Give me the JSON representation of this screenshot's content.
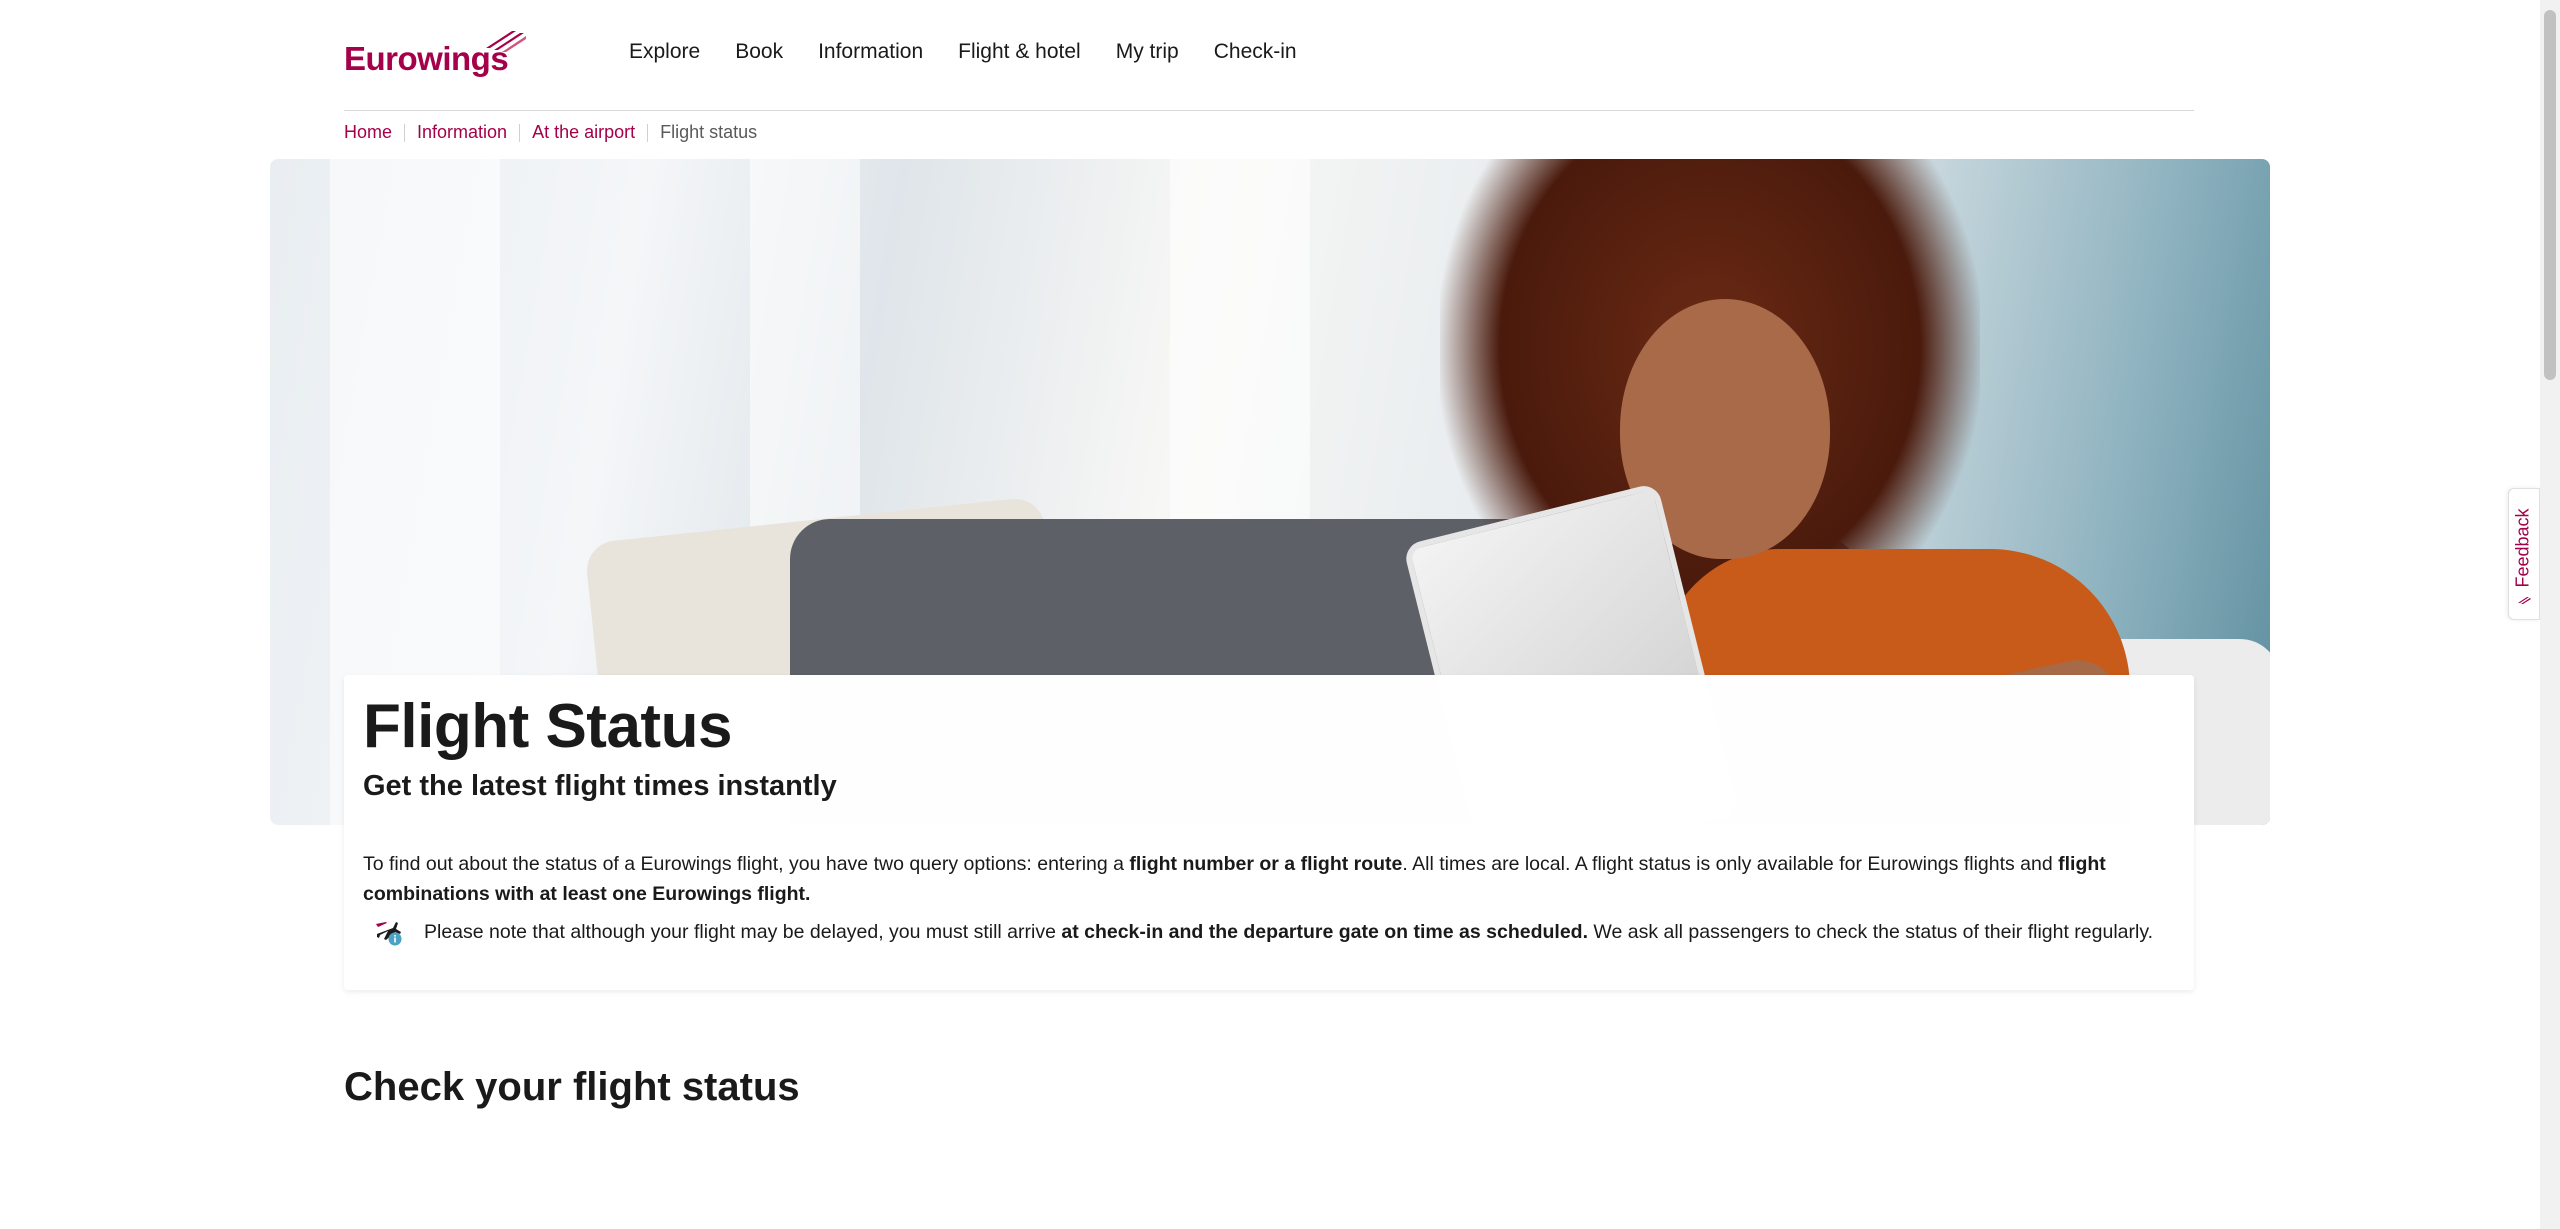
{
  "header": {
    "logo_text": "Eurowings",
    "nav": [
      "Explore",
      "Book",
      "Information",
      "Flight & hotel",
      "My trip",
      "Check-in"
    ]
  },
  "breadcrumb": [
    "Home",
    "Information",
    "At the airport",
    "Flight status"
  ],
  "hero": {
    "title": "Flight Status",
    "subtitle": "Get the latest flight times instantly"
  },
  "intro": {
    "p1_a": "To find out about the status of a Eurowings flight, you have two query options: entering a ",
    "p1_b": "flight number or a flight route",
    "p1_c": ". All times are local. A flight status is only available for Eurowings flights and ",
    "p1_d": "flight combinations with at least one Eurowings flight."
  },
  "note": {
    "a": "Please note that although your flight may be delayed, you must still arrive ",
    "b": "at check-in and the departure gate on time as scheduled.",
    "c": " We ask all passengers to check the status of their flight regularly."
  },
  "section": {
    "title": "Check your flight status"
  },
  "feedback": {
    "label": "Feedback"
  },
  "colors": {
    "brand": "#a5004a",
    "text": "#1a1a1a"
  }
}
